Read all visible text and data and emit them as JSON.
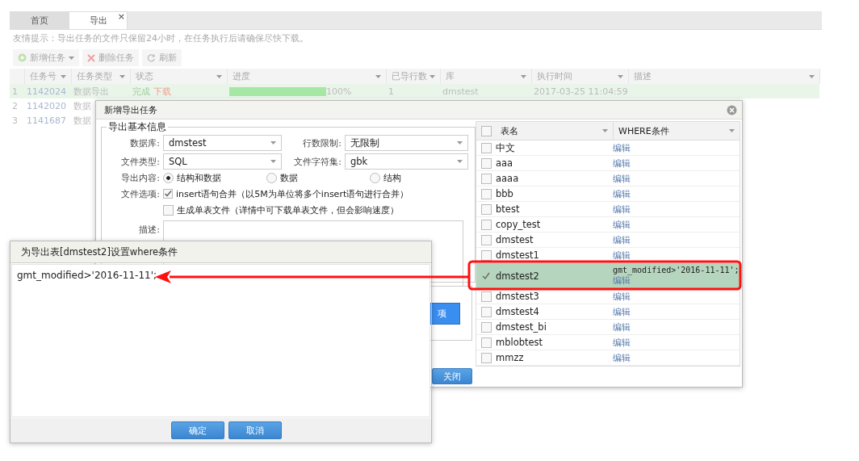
{
  "tabs": [
    {
      "label": "首页",
      "selected": false
    },
    {
      "label": "导出",
      "selected": true,
      "close": "×"
    }
  ],
  "notice": "友情提示：导出任务的文件只保留24小时，在任务执行后请确保尽快下载。",
  "toolbar": [
    {
      "kind": "add",
      "label": "新增任务",
      "dropdown": true
    },
    {
      "kind": "delete",
      "label": "删除任务",
      "dropdown": false
    },
    {
      "kind": "refresh",
      "label": "刷新",
      "dropdown": false
    }
  ],
  "task_table": {
    "columns": [
      "任务号",
      "任务类型",
      "状态",
      "进度",
      "已导行数",
      "库",
      "执行时间",
      "描述"
    ],
    "rows": [
      {
        "index": "1",
        "task_id": "1142024",
        "type": "数据导出",
        "status": "完成",
        "action": "下载",
        "level": 1,
        "percent": "100%",
        "rows_exported": "1",
        "database": "dmstest",
        "time": "2017-03-25 11:04:59",
        "selected": true
      },
      {
        "index": "2",
        "task_id": "1142020",
        "type": "数据",
        "selected": false
      },
      {
        "index": "3",
        "task_id": "1141687",
        "type": "数据",
        "selected": false
      }
    ]
  },
  "export_dialog": {
    "title": "新增导出任务",
    "section": "导出基本信息",
    "fields": [
      {
        "label": "数据库:",
        "value": "dmstest"
      },
      {
        "label": "行数限制:",
        "value": "无限制"
      },
      {
        "label": "文件类型:",
        "value": "SQL"
      },
      {
        "label": "文件字符集:",
        "value": "gbk"
      }
    ],
    "content": {
      "label": "导出内容:",
      "options": [
        {
          "label": "结构和数据",
          "selected": true
        },
        {
          "label": "数据",
          "selected": false
        },
        {
          "label": "结构",
          "selected": false
        }
      ]
    },
    "file_options": {
      "label": "文件选项:",
      "options": [
        {
          "label": "insert语句合并（以5M为单位将多个insert语句进行合并）",
          "checked": true
        },
        {
          "label": "生成单表文件（详情中可下载单表文件，但会影响速度）",
          "checked": false
        }
      ]
    },
    "description_label": "描述:",
    "primary_button": "项",
    "close_button": "关闭",
    "table": {
      "columns": [
        "表名",
        "WHERE条件"
      ],
      "all_checked": false,
      "rows": [
        {
          "name": "中文",
          "edit": "编辑",
          "selected": false
        },
        {
          "name": "aaa",
          "edit": "编辑",
          "selected": false
        },
        {
          "name": "aaaa",
          "edit": "编辑",
          "selected": false
        },
        {
          "name": "bbb",
          "edit": "编辑",
          "selected": false
        },
        {
          "name": "btest",
          "edit": "编辑",
          "selected": false
        },
        {
          "name": "copy_test",
          "edit": "编辑",
          "selected": false
        },
        {
          "name": "dmstest",
          "edit": "编辑",
          "selected": false
        },
        {
          "name": "dmstest1",
          "edit": "编辑",
          "selected": false
        },
        {
          "name": "dmstest2",
          "where": "gmt_modified>'2016-11-11';",
          "edit": "编辑",
          "selected": true
        },
        {
          "name": "dmstest3",
          "edit": "编辑",
          "selected": false
        },
        {
          "name": "dmstest4",
          "edit": "编辑",
          "selected": false
        },
        {
          "name": "dmstest_bi",
          "edit": "编辑",
          "selected": false
        },
        {
          "name": "mblobtest",
          "edit": "编辑",
          "selected": false
        },
        {
          "name": "mmzz",
          "edit": "编辑",
          "selected": false
        }
      ]
    }
  },
  "where_dialog": {
    "title": "为导出表[dmstest2]设置where条件",
    "value": "gmt_modified>'2016-11-11';",
    "buttons": [
      "确定",
      "取消"
    ]
  }
}
